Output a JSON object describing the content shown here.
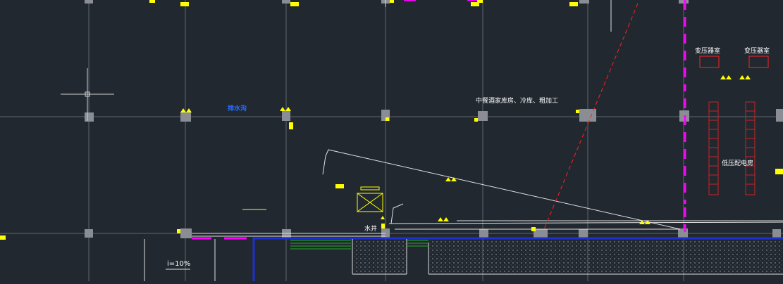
{
  "canvas": {
    "background": "#212830",
    "colors": {
      "grid": "#5e6670",
      "column": "#8a8e94",
      "annotation": "#ffff00",
      "wall": "#ffffff",
      "partition": "#ff00ff",
      "pipe_blue": "#1f2fd0",
      "section_line": "#ff2020",
      "equipment": "#ff2020",
      "stairs": "#cc2222",
      "green_lines": "#22aa22",
      "tag_blue": "#2a6cff"
    }
  },
  "labels": {
    "kitchen_room": "中餐酒家库房、冷库、粗加工",
    "transformer_room_1": "变压器室",
    "transformer_room_2": "变压器室",
    "low_voltage_room": "低压配电房",
    "water_well": "水井",
    "slope_note": "i=10%",
    "blue_tag": "排水沟"
  },
  "icons": {
    "crosshair": "crosshair-cursor-icon",
    "column": "column-square-icon",
    "fixture": "fixture-symbol-icon"
  }
}
